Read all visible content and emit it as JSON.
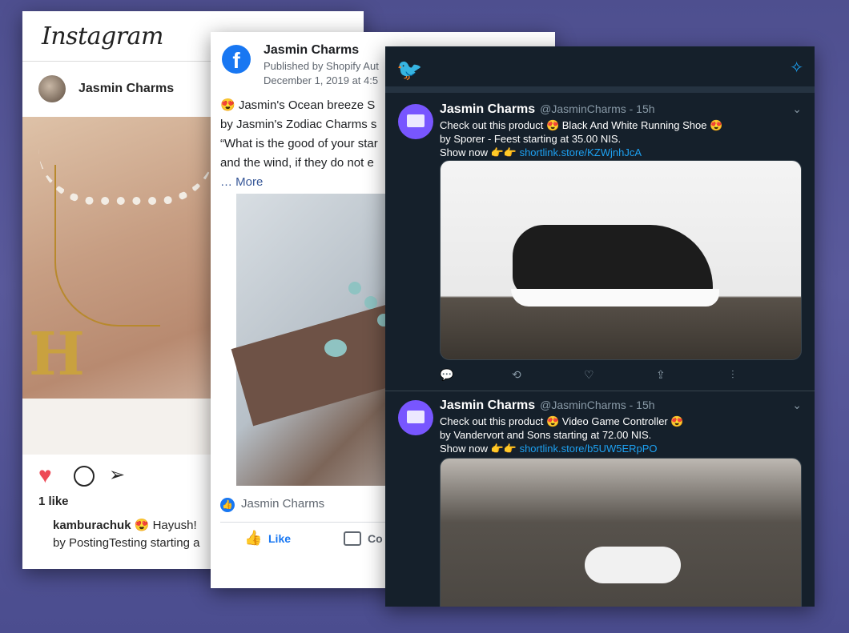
{
  "instagram": {
    "logo": "Instagram",
    "account": "Jasmin Charms",
    "image_letter": "H",
    "heart_icon": "heart-icon",
    "likes": "1 like",
    "caption_user": "kamburachuk",
    "caption_emoji": "😍",
    "caption_line1": "Hayush!",
    "caption_line2": "by PostingTesting starting a"
  },
  "facebook": {
    "page_name": "Jasmin Charms",
    "published_by": "Published by Shopify Aut",
    "date": "December 1, 2019 at 4:5",
    "line1": "😍 Jasmin's Ocean breeze S",
    "line2": "by Jasmin's Zodiac Charms s",
    "line3": "“What is the good of your star",
    "line4": "and the wind, if they do not e",
    "more": "… More",
    "footer_page": "Jasmin Charms",
    "like_label": "Like",
    "comment_label": "Co",
    "accent": "#1877f2"
  },
  "twitter": {
    "accent": "#1da1f2",
    "tweets": [
      {
        "name": "Jasmin Charms",
        "handle": "@JasminCharms - 15h",
        "line1": "Check out this product 😍 Black And White Running Shoe 😍",
        "line2": "by Sporer - Feest starting at 35.00 NIS.",
        "line3_prefix": "Show now 👉👉 ",
        "link": "shortlink.store/KZWjnhJcA"
      },
      {
        "name": "Jasmin Charms",
        "handle": "@JasminCharms - 15h",
        "line1": "Check out this product 😍 Video Game Controller 😍",
        "line2": "by Vandervort and Sons starting at 72.00 NIS.",
        "line3_prefix": "Show now 👉👉 ",
        "link": "shortlink.store/b5UW5ERpPO"
      }
    ]
  }
}
